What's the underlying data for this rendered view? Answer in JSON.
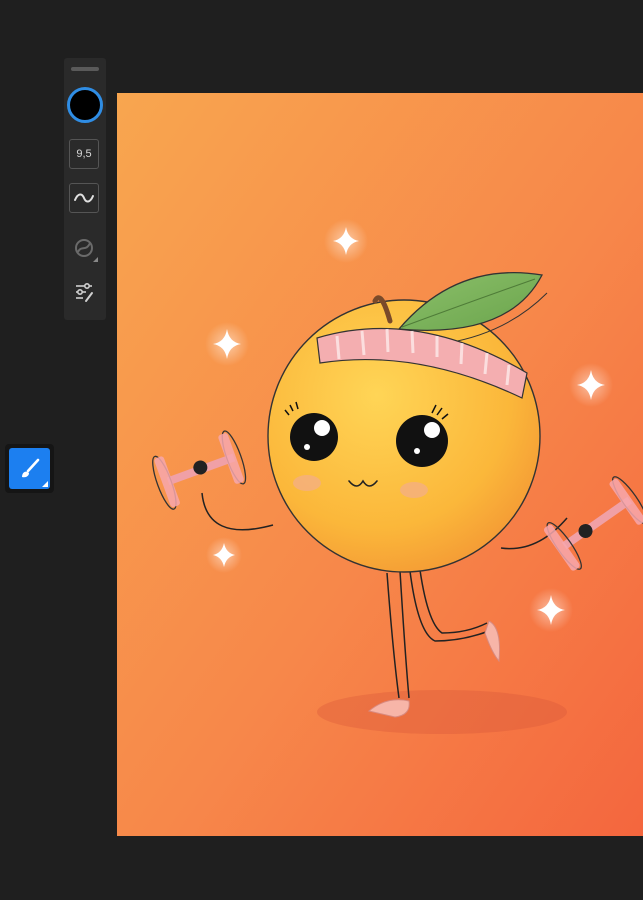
{
  "toolbar": {
    "brush_size": "9,5",
    "active_color": "#000000",
    "accent": "#2f8de4",
    "icons": [
      "color-swatch",
      "brush-size",
      "smoothing-wave-icon",
      "stabilizer-icon",
      "brush-settings-icon"
    ]
  },
  "tool_rail": {
    "active_tool_icon": "brush-icon",
    "active_color": "#1c7ff0"
  },
  "canvas": {
    "background_gradient": [
      "#f9a34e",
      "#f6703f"
    ],
    "subject": "orange-character-illustration"
  }
}
